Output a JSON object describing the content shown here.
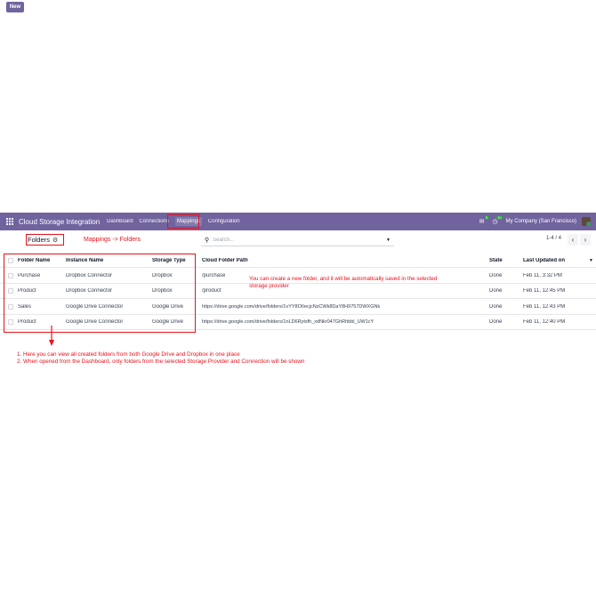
{
  "navbar": {
    "app_title": "Cloud Storage Integration",
    "items": [
      {
        "label": "Dashboard"
      },
      {
        "label": "Connections"
      },
      {
        "label": "Mappings"
      },
      {
        "label": "Configuration"
      }
    ],
    "chat_badge": "5",
    "activity_badge": "10",
    "company": "My Company (San Francisco)",
    "bg_color": "#71639e"
  },
  "control": {
    "new_label": "New",
    "breadcrumb": "Folders",
    "search_placeholder": "Search...",
    "pager": "1-4 / 4",
    "prev": "‹",
    "next": "›"
  },
  "table": {
    "headers": [
      "Folder Name",
      "Instance Name",
      "Storage Type",
      "Cloud Folder Path",
      "State",
      "Last Updated on"
    ],
    "rows": [
      [
        "Purchase",
        "Dropbox Connector",
        "Dropbox",
        "/purchase",
        "Done",
        "Feb 11, 3:32 PM"
      ],
      [
        "Product",
        "Dropbox Connector",
        "Dropbox",
        "/product",
        "Done",
        "Feb 11, 12:45 PM"
      ],
      [
        "Sales",
        "Google Drive Connector",
        "Google Drive",
        "https://drive.google.com/drive/folders/1vYY8OIIecjcNzCWk8DaY8H9757DWXGNk",
        "Done",
        "Feb 11, 12:43 PM"
      ],
      [
        "Product",
        "Google Drive Connector",
        "Google Drive",
        "https://drive.google.com/drive/folders/1nLD6Rytsfh_xdNkr047GhRhbbl_UW1cY",
        "Done",
        "Feb 11, 12:40 PM"
      ]
    ]
  },
  "annotations": {
    "mappings_folders": "Mappings -> Folders",
    "create_folder_1": "You can create a new folder, and it will be automatically saved in the selected",
    "create_folder_2": "storage provider",
    "note_1": "1. Here you can view all created folders from both Google Drive and Dropbox in one place",
    "note_2": "2. When opened from the Dashboard, only folders from the selected Storage Provider and Connection will be shown",
    "color": "#e8111b"
  }
}
